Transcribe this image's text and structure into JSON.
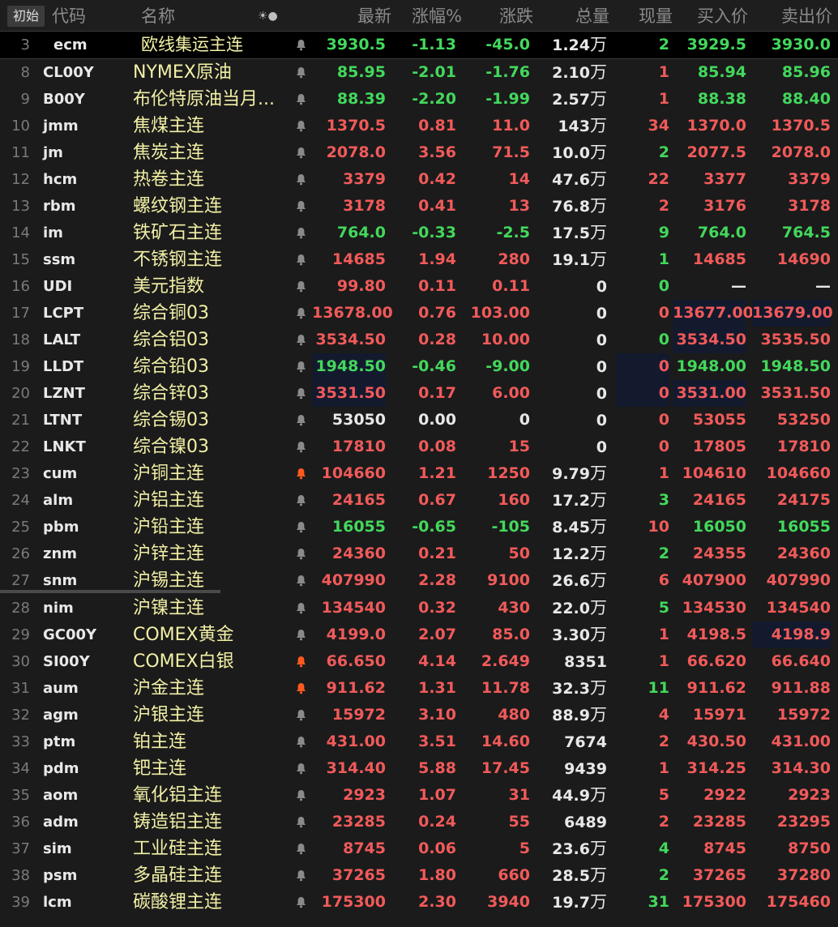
{
  "header": {
    "corner_label": "初始",
    "columns": [
      "代码",
      "名称",
      "最新",
      "涨幅%",
      "涨跌",
      "总量",
      "现量",
      "买入价",
      "卖出价"
    ],
    "icon_glyphs": "☀●"
  },
  "colors": {
    "up": "#f15a5a",
    "down": "#43d85c",
    "flat": "#e8e8e8",
    "name": "#f2f0a6",
    "bell_active": "#ff5a1e",
    "bell": "#8a8a8a"
  },
  "rows": [
    {
      "idx": "3",
      "code": "ecm",
      "name": "欧线集运主连",
      "last": "3930.5",
      "pct": "-1.13",
      "chg": "-45.0",
      "vol": "1.24",
      "vol_unit": "万",
      "cur": "2",
      "bid": "3929.5",
      "ask": "3930.0",
      "dir": "dn",
      "cur_dir": "dn",
      "bid_dir": "dn",
      "ask_dir": "dn",
      "selected": true
    },
    {
      "idx": "8",
      "code": "CL00Y",
      "name": "NYMEX原油",
      "last": "85.95",
      "pct": "-2.01",
      "chg": "-1.76",
      "vol": "2.10",
      "vol_unit": "万",
      "cur": "1",
      "bid": "85.94",
      "ask": "85.96",
      "dir": "dn",
      "cur_dir": "up",
      "bid_dir": "dn",
      "ask_dir": "dn"
    },
    {
      "idx": "9",
      "code": "B00Y",
      "name": "布伦特原油当月...",
      "last": "88.39",
      "pct": "-2.20",
      "chg": "-1.99",
      "vol": "2.57",
      "vol_unit": "万",
      "cur": "1",
      "bid": "88.38",
      "ask": "88.40",
      "dir": "dn",
      "cur_dir": "up",
      "bid_dir": "dn",
      "ask_dir": "dn"
    },
    {
      "idx": "10",
      "code": "jmm",
      "name": "焦煤主连",
      "last": "1370.5",
      "pct": "0.81",
      "chg": "11.0",
      "vol": "143",
      "vol_unit": "万",
      "cur": "34",
      "bid": "1370.0",
      "ask": "1370.5",
      "dir": "up",
      "cur_dir": "up",
      "bid_dir": "up",
      "ask_dir": "up"
    },
    {
      "idx": "11",
      "code": "jm",
      "name": "焦炭主连",
      "last": "2078.0",
      "pct": "3.56",
      "chg": "71.5",
      "vol": "10.0",
      "vol_unit": "万",
      "cur": "2",
      "bid": "2077.5",
      "ask": "2078.0",
      "dir": "up",
      "cur_dir": "dn",
      "bid_dir": "up",
      "ask_dir": "up"
    },
    {
      "idx": "12",
      "code": "hcm",
      "name": "热卷主连",
      "last": "3379",
      "pct": "0.42",
      "chg": "14",
      "vol": "47.6",
      "vol_unit": "万",
      "cur": "22",
      "bid": "3377",
      "ask": "3379",
      "dir": "up",
      "cur_dir": "up",
      "bid_dir": "up",
      "ask_dir": "up"
    },
    {
      "idx": "13",
      "code": "rbm",
      "name": "螺纹钢主连",
      "last": "3178",
      "pct": "0.41",
      "chg": "13",
      "vol": "76.8",
      "vol_unit": "万",
      "cur": "2",
      "bid": "3176",
      "ask": "3178",
      "dir": "up",
      "cur_dir": "up",
      "bid_dir": "up",
      "ask_dir": "up"
    },
    {
      "idx": "14",
      "code": "im",
      "name": "铁矿石主连",
      "last": "764.0",
      "pct": "-0.33",
      "chg": "-2.5",
      "vol": "17.5",
      "vol_unit": "万",
      "cur": "9",
      "bid": "764.0",
      "ask": "764.5",
      "dir": "dn",
      "cur_dir": "dn",
      "bid_dir": "dn",
      "ask_dir": "dn"
    },
    {
      "idx": "15",
      "code": "ssm",
      "name": "不锈钢主连",
      "last": "14685",
      "pct": "1.94",
      "chg": "280",
      "vol": "19.1",
      "vol_unit": "万",
      "cur": "1",
      "bid": "14685",
      "ask": "14690",
      "dir": "up",
      "cur_dir": "dn",
      "bid_dir": "up",
      "ask_dir": "up"
    },
    {
      "idx": "16",
      "code": "UDI",
      "name": "美元指数",
      "last": "99.80",
      "pct": "0.11",
      "chg": "0.11",
      "vol": "0",
      "vol_unit": "",
      "cur": "0",
      "bid": "—",
      "ask": "—",
      "dir": "up",
      "cur_dir": "dn",
      "bid_dir": "eq",
      "ask_dir": "eq"
    },
    {
      "idx": "17",
      "code": "LCPT",
      "name": "综合铜03",
      "last": "13678.00",
      "pct": "0.76",
      "chg": "103.00",
      "vol": "0",
      "vol_unit": "",
      "cur": "0",
      "bid": "13677.00",
      "ask": "13679.00",
      "dir": "up",
      "cur_dir": "up",
      "bid_dir": "up",
      "ask_dir": "up",
      "hl": [
        "bid",
        "ask"
      ]
    },
    {
      "idx": "18",
      "code": "LALT",
      "name": "综合铝03",
      "last": "3534.50",
      "pct": "0.28",
      "chg": "10.00",
      "vol": "0",
      "vol_unit": "",
      "cur": "0",
      "bid": "3534.50",
      "ask": "3535.50",
      "dir": "up",
      "cur_dir": "dn",
      "bid_dir": "up",
      "ask_dir": "up",
      "hl": [
        "bid"
      ]
    },
    {
      "idx": "19",
      "code": "LLDT",
      "name": "综合铅03",
      "last": "1948.50",
      "pct": "-0.46",
      "chg": "-9.00",
      "vol": "0",
      "vol_unit": "",
      "cur": "0",
      "bid": "1948.00",
      "ask": "1948.50",
      "dir": "dn",
      "cur_dir": "up",
      "bid_dir": "dn",
      "ask_dir": "dn",
      "hl": [
        "last",
        "cur"
      ]
    },
    {
      "idx": "20",
      "code": "LZNT",
      "name": "综合锌03",
      "last": "3531.50",
      "pct": "0.17",
      "chg": "6.00",
      "vol": "0",
      "vol_unit": "",
      "cur": "0",
      "bid": "3531.00",
      "ask": "3531.50",
      "dir": "up",
      "cur_dir": "up",
      "bid_dir": "up",
      "ask_dir": "up",
      "hl": [
        "last",
        "cur",
        "bid"
      ]
    },
    {
      "idx": "21",
      "code": "LTNT",
      "name": "综合锡03",
      "last": "53050",
      "pct": "0.00",
      "chg": "0",
      "vol": "0",
      "vol_unit": "",
      "cur": "0",
      "bid": "53055",
      "ask": "53250",
      "dir": "eq",
      "cur_dir": "up",
      "bid_dir": "up",
      "ask_dir": "up"
    },
    {
      "idx": "22",
      "code": "LNKT",
      "name": "综合镍03",
      "last": "17810",
      "pct": "0.08",
      "chg": "15",
      "vol": "0",
      "vol_unit": "",
      "cur": "0",
      "bid": "17805",
      "ask": "17810",
      "dir": "up",
      "cur_dir": "up",
      "bid_dir": "up",
      "ask_dir": "up"
    },
    {
      "idx": "23",
      "code": "cum",
      "name": "沪铜主连",
      "last": "104660",
      "pct": "1.21",
      "chg": "1250",
      "vol": "9.79",
      "vol_unit": "万",
      "cur": "1",
      "bid": "104610",
      "ask": "104660",
      "dir": "up",
      "cur_dir": "up",
      "bid_dir": "up",
      "ask_dir": "up",
      "bell_active": true
    },
    {
      "idx": "24",
      "code": "alm",
      "name": "沪铝主连",
      "last": "24165",
      "pct": "0.67",
      "chg": "160",
      "vol": "17.2",
      "vol_unit": "万",
      "cur": "3",
      "bid": "24165",
      "ask": "24175",
      "dir": "up",
      "cur_dir": "dn",
      "bid_dir": "up",
      "ask_dir": "up"
    },
    {
      "idx": "25",
      "code": "pbm",
      "name": "沪铅主连",
      "last": "16055",
      "pct": "-0.65",
      "chg": "-105",
      "vol": "8.45",
      "vol_unit": "万",
      "cur": "10",
      "bid": "16050",
      "ask": "16055",
      "dir": "dn",
      "cur_dir": "up",
      "bid_dir": "dn",
      "ask_dir": "dn"
    },
    {
      "idx": "26",
      "code": "znm",
      "name": "沪锌主连",
      "last": "24360",
      "pct": "0.21",
      "chg": "50",
      "vol": "12.2",
      "vol_unit": "万",
      "cur": "2",
      "bid": "24355",
      "ask": "24360",
      "dir": "up",
      "cur_dir": "dn",
      "bid_dir": "up",
      "ask_dir": "up"
    },
    {
      "idx": "27",
      "code": "snm",
      "name": "沪锡主连",
      "last": "407990",
      "pct": "2.28",
      "chg": "9100",
      "vol": "26.6",
      "vol_unit": "万",
      "cur": "6",
      "bid": "407900",
      "ask": "407990",
      "dir": "up",
      "cur_dir": "up",
      "bid_dir": "up",
      "ask_dir": "up"
    },
    {
      "idx": "28",
      "code": "nim",
      "name": "沪镍主连",
      "last": "134540",
      "pct": "0.32",
      "chg": "430",
      "vol": "22.0",
      "vol_unit": "万",
      "cur": "5",
      "bid": "134530",
      "ask": "134540",
      "dir": "up",
      "cur_dir": "dn",
      "bid_dir": "up",
      "ask_dir": "up"
    },
    {
      "idx": "29",
      "code": "GC00Y",
      "name": "COMEX黄金",
      "last": "4199.0",
      "pct": "2.07",
      "chg": "85.0",
      "vol": "3.30",
      "vol_unit": "万",
      "cur": "1",
      "bid": "4198.5",
      "ask": "4198.9",
      "dir": "up",
      "cur_dir": "up",
      "bid_dir": "up",
      "ask_dir": "up",
      "hl": [
        "ask"
      ]
    },
    {
      "idx": "30",
      "code": "SI00Y",
      "name": "COMEX白银",
      "last": "66.650",
      "pct": "4.14",
      "chg": "2.649",
      "vol": "8351",
      "vol_unit": "",
      "cur": "1",
      "bid": "66.620",
      "ask": "66.640",
      "dir": "up",
      "cur_dir": "up",
      "bid_dir": "up",
      "ask_dir": "up",
      "bell_active": true
    },
    {
      "idx": "31",
      "code": "aum",
      "name": "沪金主连",
      "last": "911.62",
      "pct": "1.31",
      "chg": "11.78",
      "vol": "32.3",
      "vol_unit": "万",
      "cur": "11",
      "bid": "911.62",
      "ask": "911.88",
      "dir": "up",
      "cur_dir": "dn",
      "bid_dir": "up",
      "ask_dir": "up",
      "bell_active": true
    },
    {
      "idx": "32",
      "code": "agm",
      "name": "沪银主连",
      "last": "15972",
      "pct": "3.10",
      "chg": "480",
      "vol": "88.9",
      "vol_unit": "万",
      "cur": "4",
      "bid": "15971",
      "ask": "15972",
      "dir": "up",
      "cur_dir": "up",
      "bid_dir": "up",
      "ask_dir": "up"
    },
    {
      "idx": "33",
      "code": "ptm",
      "name": "铂主连",
      "last": "431.00",
      "pct": "3.51",
      "chg": "14.60",
      "vol": "7674",
      "vol_unit": "",
      "cur": "2",
      "bid": "430.50",
      "ask": "431.00",
      "dir": "up",
      "cur_dir": "up",
      "bid_dir": "up",
      "ask_dir": "up"
    },
    {
      "idx": "34",
      "code": "pdm",
      "name": "钯主连",
      "last": "314.40",
      "pct": "5.88",
      "chg": "17.45",
      "vol": "9439",
      "vol_unit": "",
      "cur": "1",
      "bid": "314.25",
      "ask": "314.30",
      "dir": "up",
      "cur_dir": "up",
      "bid_dir": "up",
      "ask_dir": "up"
    },
    {
      "idx": "35",
      "code": "aom",
      "name": "氧化铝主连",
      "last": "2923",
      "pct": "1.07",
      "chg": "31",
      "vol": "44.9",
      "vol_unit": "万",
      "cur": "5",
      "bid": "2922",
      "ask": "2923",
      "dir": "up",
      "cur_dir": "up",
      "bid_dir": "up",
      "ask_dir": "up"
    },
    {
      "idx": "36",
      "code": "adm",
      "name": "铸造铝主连",
      "last": "23285",
      "pct": "0.24",
      "chg": "55",
      "vol": "6489",
      "vol_unit": "",
      "cur": "2",
      "bid": "23285",
      "ask": "23295",
      "dir": "up",
      "cur_dir": "up",
      "bid_dir": "up",
      "ask_dir": "up"
    },
    {
      "idx": "37",
      "code": "sim",
      "name": "工业硅主连",
      "last": "8745",
      "pct": "0.06",
      "chg": "5",
      "vol": "23.6",
      "vol_unit": "万",
      "cur": "4",
      "bid": "8745",
      "ask": "8750",
      "dir": "up",
      "cur_dir": "dn",
      "bid_dir": "up",
      "ask_dir": "up"
    },
    {
      "idx": "38",
      "code": "psm",
      "name": "多晶硅主连",
      "last": "37265",
      "pct": "1.80",
      "chg": "660",
      "vol": "28.5",
      "vol_unit": "万",
      "cur": "2",
      "bid": "37265",
      "ask": "37280",
      "dir": "up",
      "cur_dir": "dn",
      "bid_dir": "up",
      "ask_dir": "up"
    },
    {
      "idx": "39",
      "code": "lcm",
      "name": "碳酸锂主连",
      "last": "175300",
      "pct": "2.30",
      "chg": "3940",
      "vol": "19.7",
      "vol_unit": "万",
      "cur": "31",
      "bid": "175300",
      "ask": "175460",
      "dir": "up",
      "cur_dir": "dn",
      "bid_dir": "up",
      "ask_dir": "up"
    }
  ]
}
